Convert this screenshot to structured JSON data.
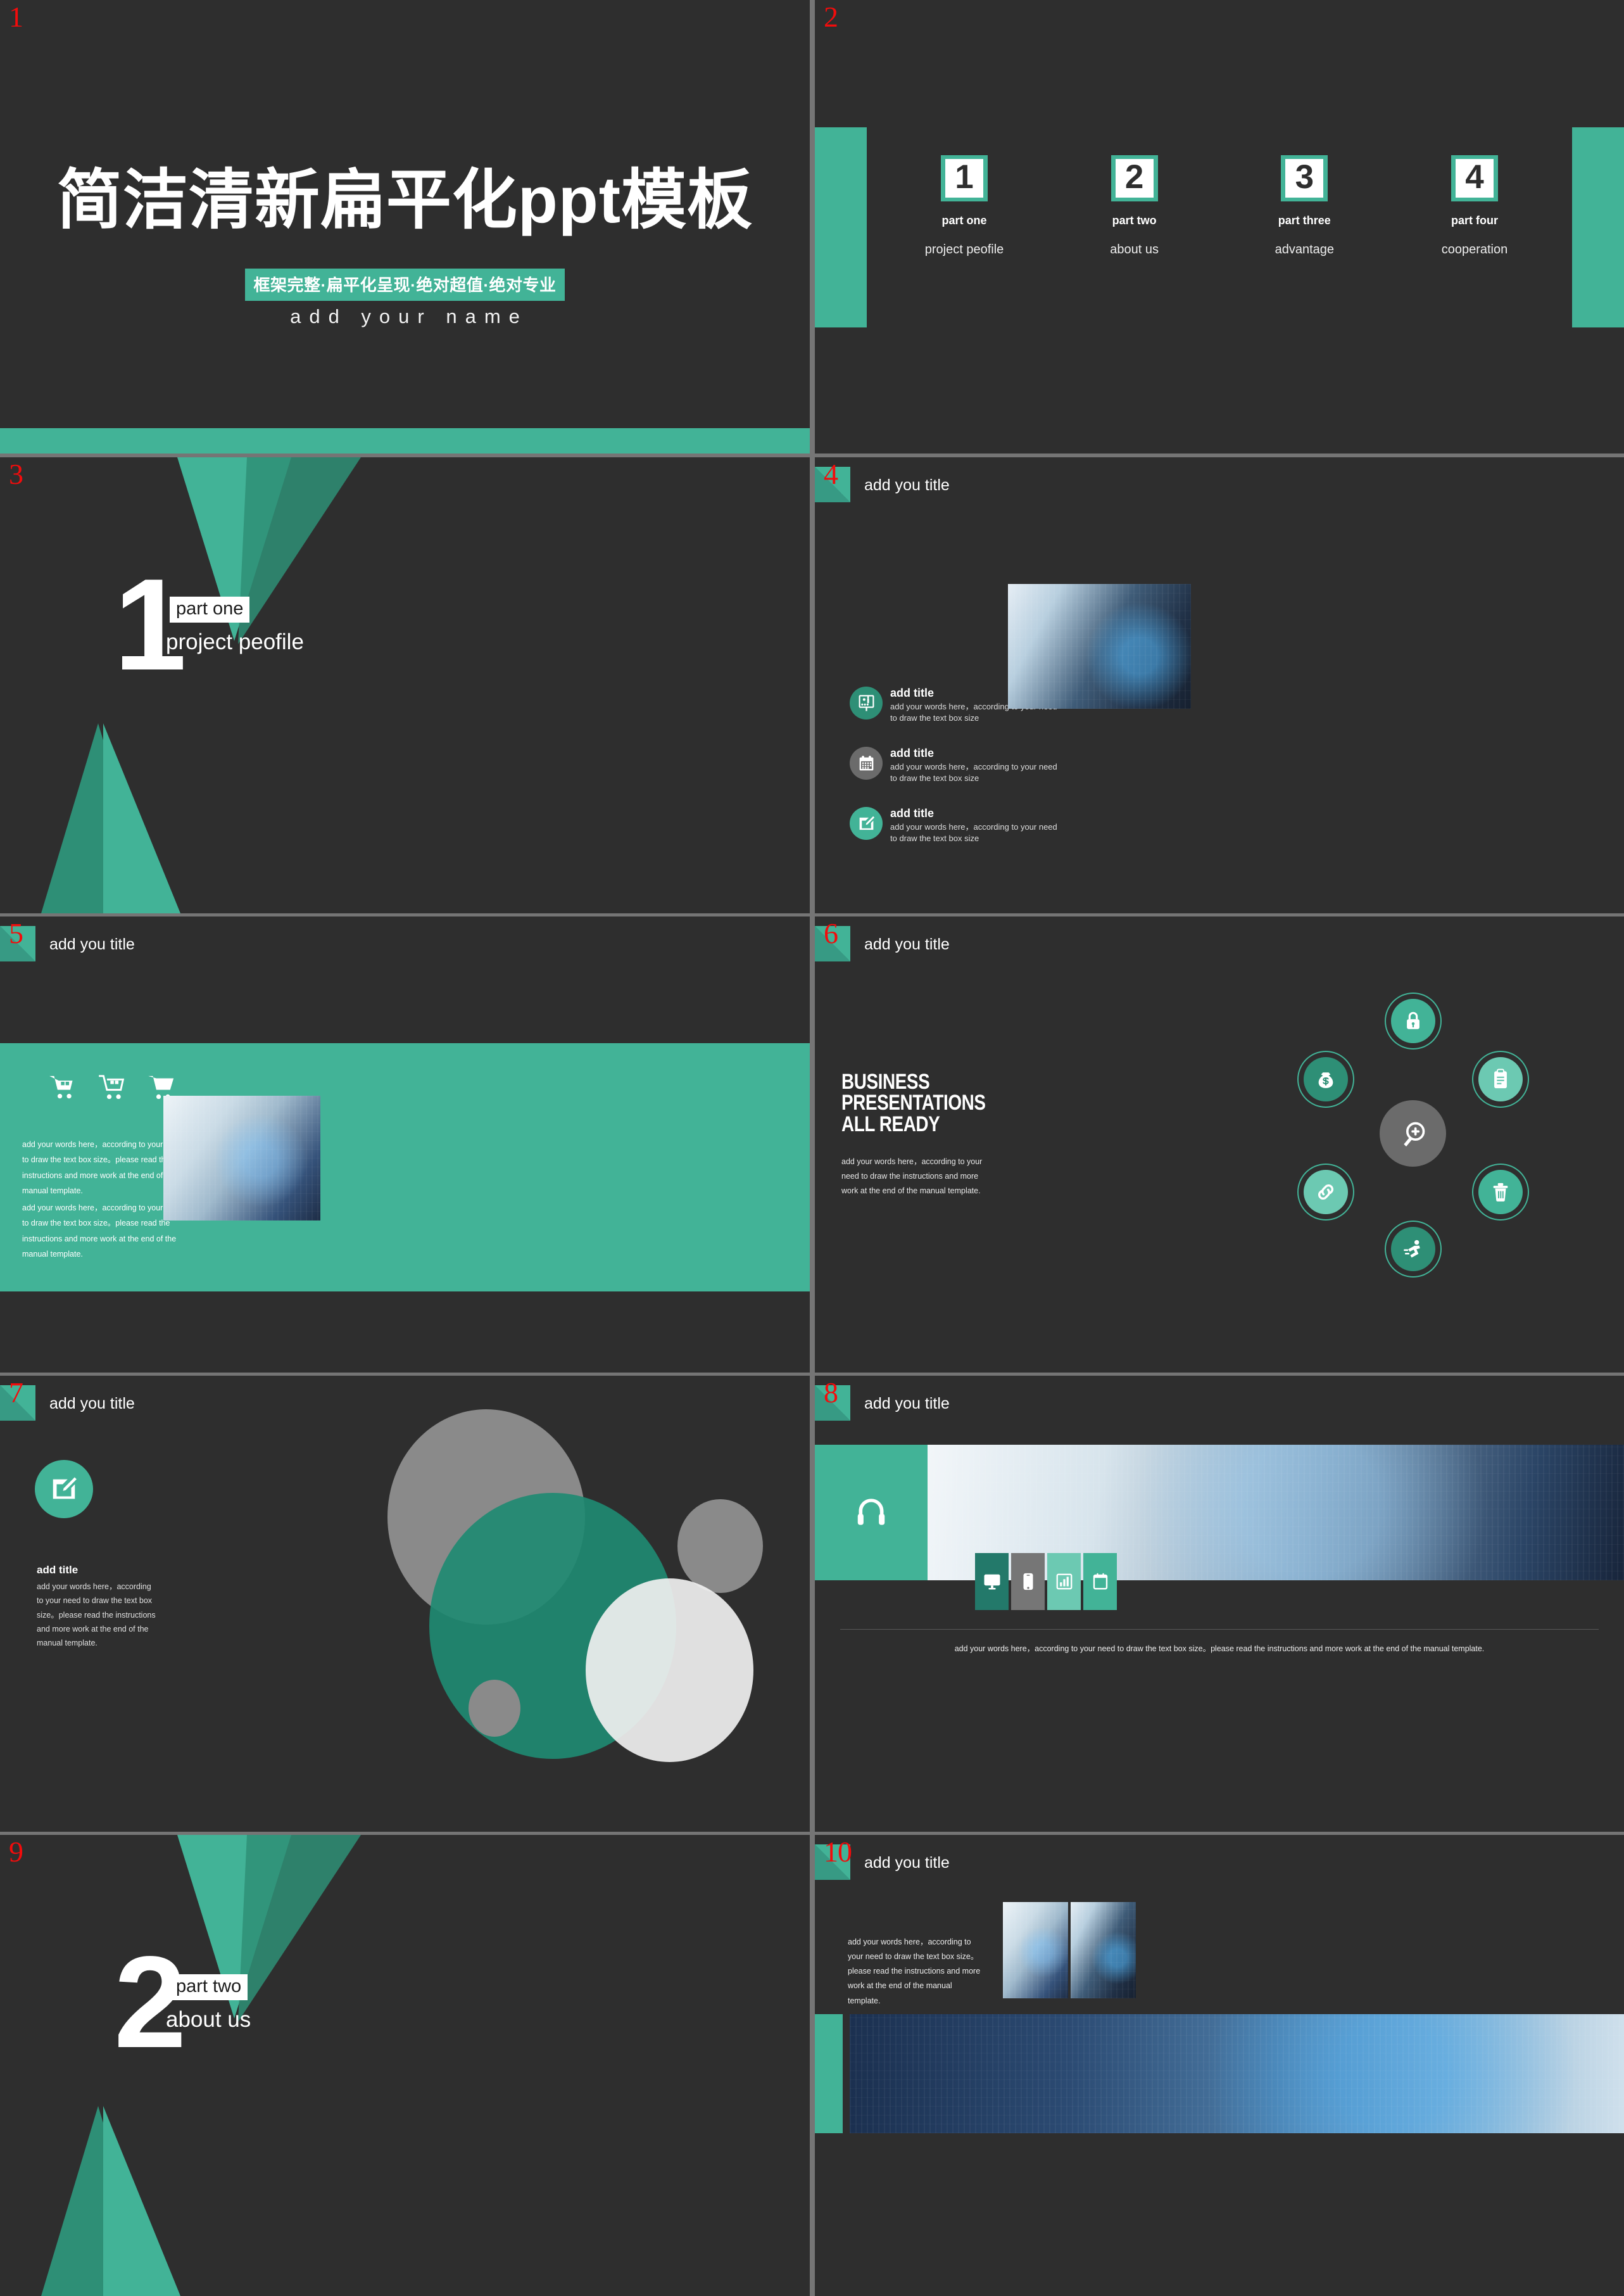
{
  "theme": {
    "teal": "#42b397",
    "teal_dark": "#2e8f76",
    "teal_light": "#6cc9b2",
    "gray": "#6b6b6b",
    "bg": "#2e2e2e",
    "page_number_color": "#f20c0c"
  },
  "slides": [
    {
      "page": "1",
      "title": "简洁清新扁平化ppt模板",
      "banner": "框架完整·扁平化呈现·绝对超值·绝对专业",
      "author": "add your name"
    },
    {
      "page": "2",
      "items": [
        {
          "num": "1",
          "part": "part one",
          "desc": "project peofile"
        },
        {
          "num": "2",
          "part": "part two",
          "desc": "about us"
        },
        {
          "num": "3",
          "part": "part three",
          "desc": "advantage"
        },
        {
          "num": "4",
          "part": "part four",
          "desc": "cooperation"
        }
      ]
    },
    {
      "page": "3",
      "number": "1",
      "tag": "part one",
      "subtitle": "project peofile"
    },
    {
      "page": "4",
      "header": "add you title",
      "list": [
        {
          "icon": "presentation-person-icon",
          "color": "#2e8f76",
          "title": "add title",
          "body": "add your words here，according to your need to draw the text box size"
        },
        {
          "icon": "calendar-icon",
          "color": "#6b6b6b",
          "title": "add title",
          "body": "add your words here，according to your need to draw the text box size"
        },
        {
          "icon": "edit-note-icon",
          "color": "#42b397",
          "title": "add title",
          "body": "add your words here，according to your need to draw the text box size"
        }
      ]
    },
    {
      "page": "5",
      "header": "add you title",
      "icons": [
        "shopping-cart-icon",
        "shopping-cart-icon",
        "shopping-cart-icon"
      ],
      "paragraph_one": "add your words here，according to your need to draw the text box size。please read the instructions and more work at the end of the manual template.",
      "paragraph_two": "add your words here，according to your need to draw the text box size。please read the instructions and more work at the end of the manual template."
    },
    {
      "page": "6",
      "header": "add you title",
      "heading_lines": [
        "BUSINESS",
        "PRESENTATIONS",
        "ALL READY"
      ],
      "paragraph": "add your words here，according to your need to draw the instructions and more work at the end of the manual template.",
      "center_icon": "magnifier-plus-icon",
      "nodes": [
        {
          "icon": "lock-icon",
          "color": "#42b397",
          "pos": "top"
        },
        {
          "icon": "clipboard-icon",
          "color": "#6cc9b2",
          "pos": "right-top"
        },
        {
          "icon": "trash-icon",
          "color": "#42b397",
          "pos": "right-bottom"
        },
        {
          "icon": "runner-icon",
          "color": "#2e8f76",
          "pos": "bottom"
        },
        {
          "icon": "link-icon",
          "color": "#6cc9b2",
          "pos": "left-bottom"
        },
        {
          "icon": "money-bag-icon",
          "color": "#2e8f76",
          "pos": "left-top"
        }
      ]
    },
    {
      "page": "7",
      "header": "add you title",
      "icon": "edit-note-icon",
      "title": "add title",
      "paragraph": "add your words here，according to your need to draw the text box size。please read the instructions and more work at the end of the manual template."
    },
    {
      "page": "8",
      "header": "add you title",
      "feature_icon": "headphones-icon",
      "tiles": [
        {
          "icon": "monitor-icon",
          "color": "#23796a"
        },
        {
          "icon": "smartphone-icon",
          "color": "#767676"
        },
        {
          "icon": "bar-chart-icon",
          "color": "#6cc9b2"
        },
        {
          "icon": "calendar-icon",
          "color": "#42b397"
        }
      ],
      "footer": "add your words here，according to your need to draw the text box size。please read the instructions and more work at the end of the manual template."
    },
    {
      "page": "9",
      "number": "2",
      "tag": "part two",
      "subtitle": "about us"
    },
    {
      "page": "10",
      "header": "add you title",
      "paragraph": "add your words here，according to your need to draw the text box size。please read the instructions and more work at the end of the manual template."
    }
  ]
}
